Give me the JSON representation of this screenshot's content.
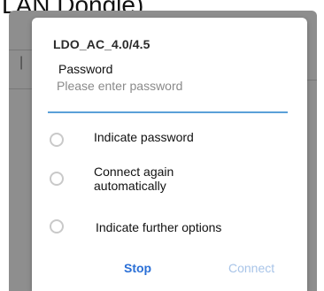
{
  "background": {
    "banner_text": "LAN Dongle)"
  },
  "dialog": {
    "title": "LDO_AC_4.0/4.5",
    "password": {
      "label": "Password",
      "placeholder": "Please enter password",
      "value": ""
    },
    "options": [
      {
        "label": "Indicate password",
        "checked": false
      },
      {
        "label": "Connect again automatically",
        "checked": false
      },
      {
        "label": "Indicate further options",
        "checked": false
      }
    ],
    "buttons": {
      "stop": "Stop",
      "connect": "Connect"
    }
  },
  "colors": {
    "accent": "#2a6fd6",
    "accent_disabled": "#a8c4e8",
    "input_underline": "#5aa0d8",
    "overlay": "#8e8e8e"
  }
}
